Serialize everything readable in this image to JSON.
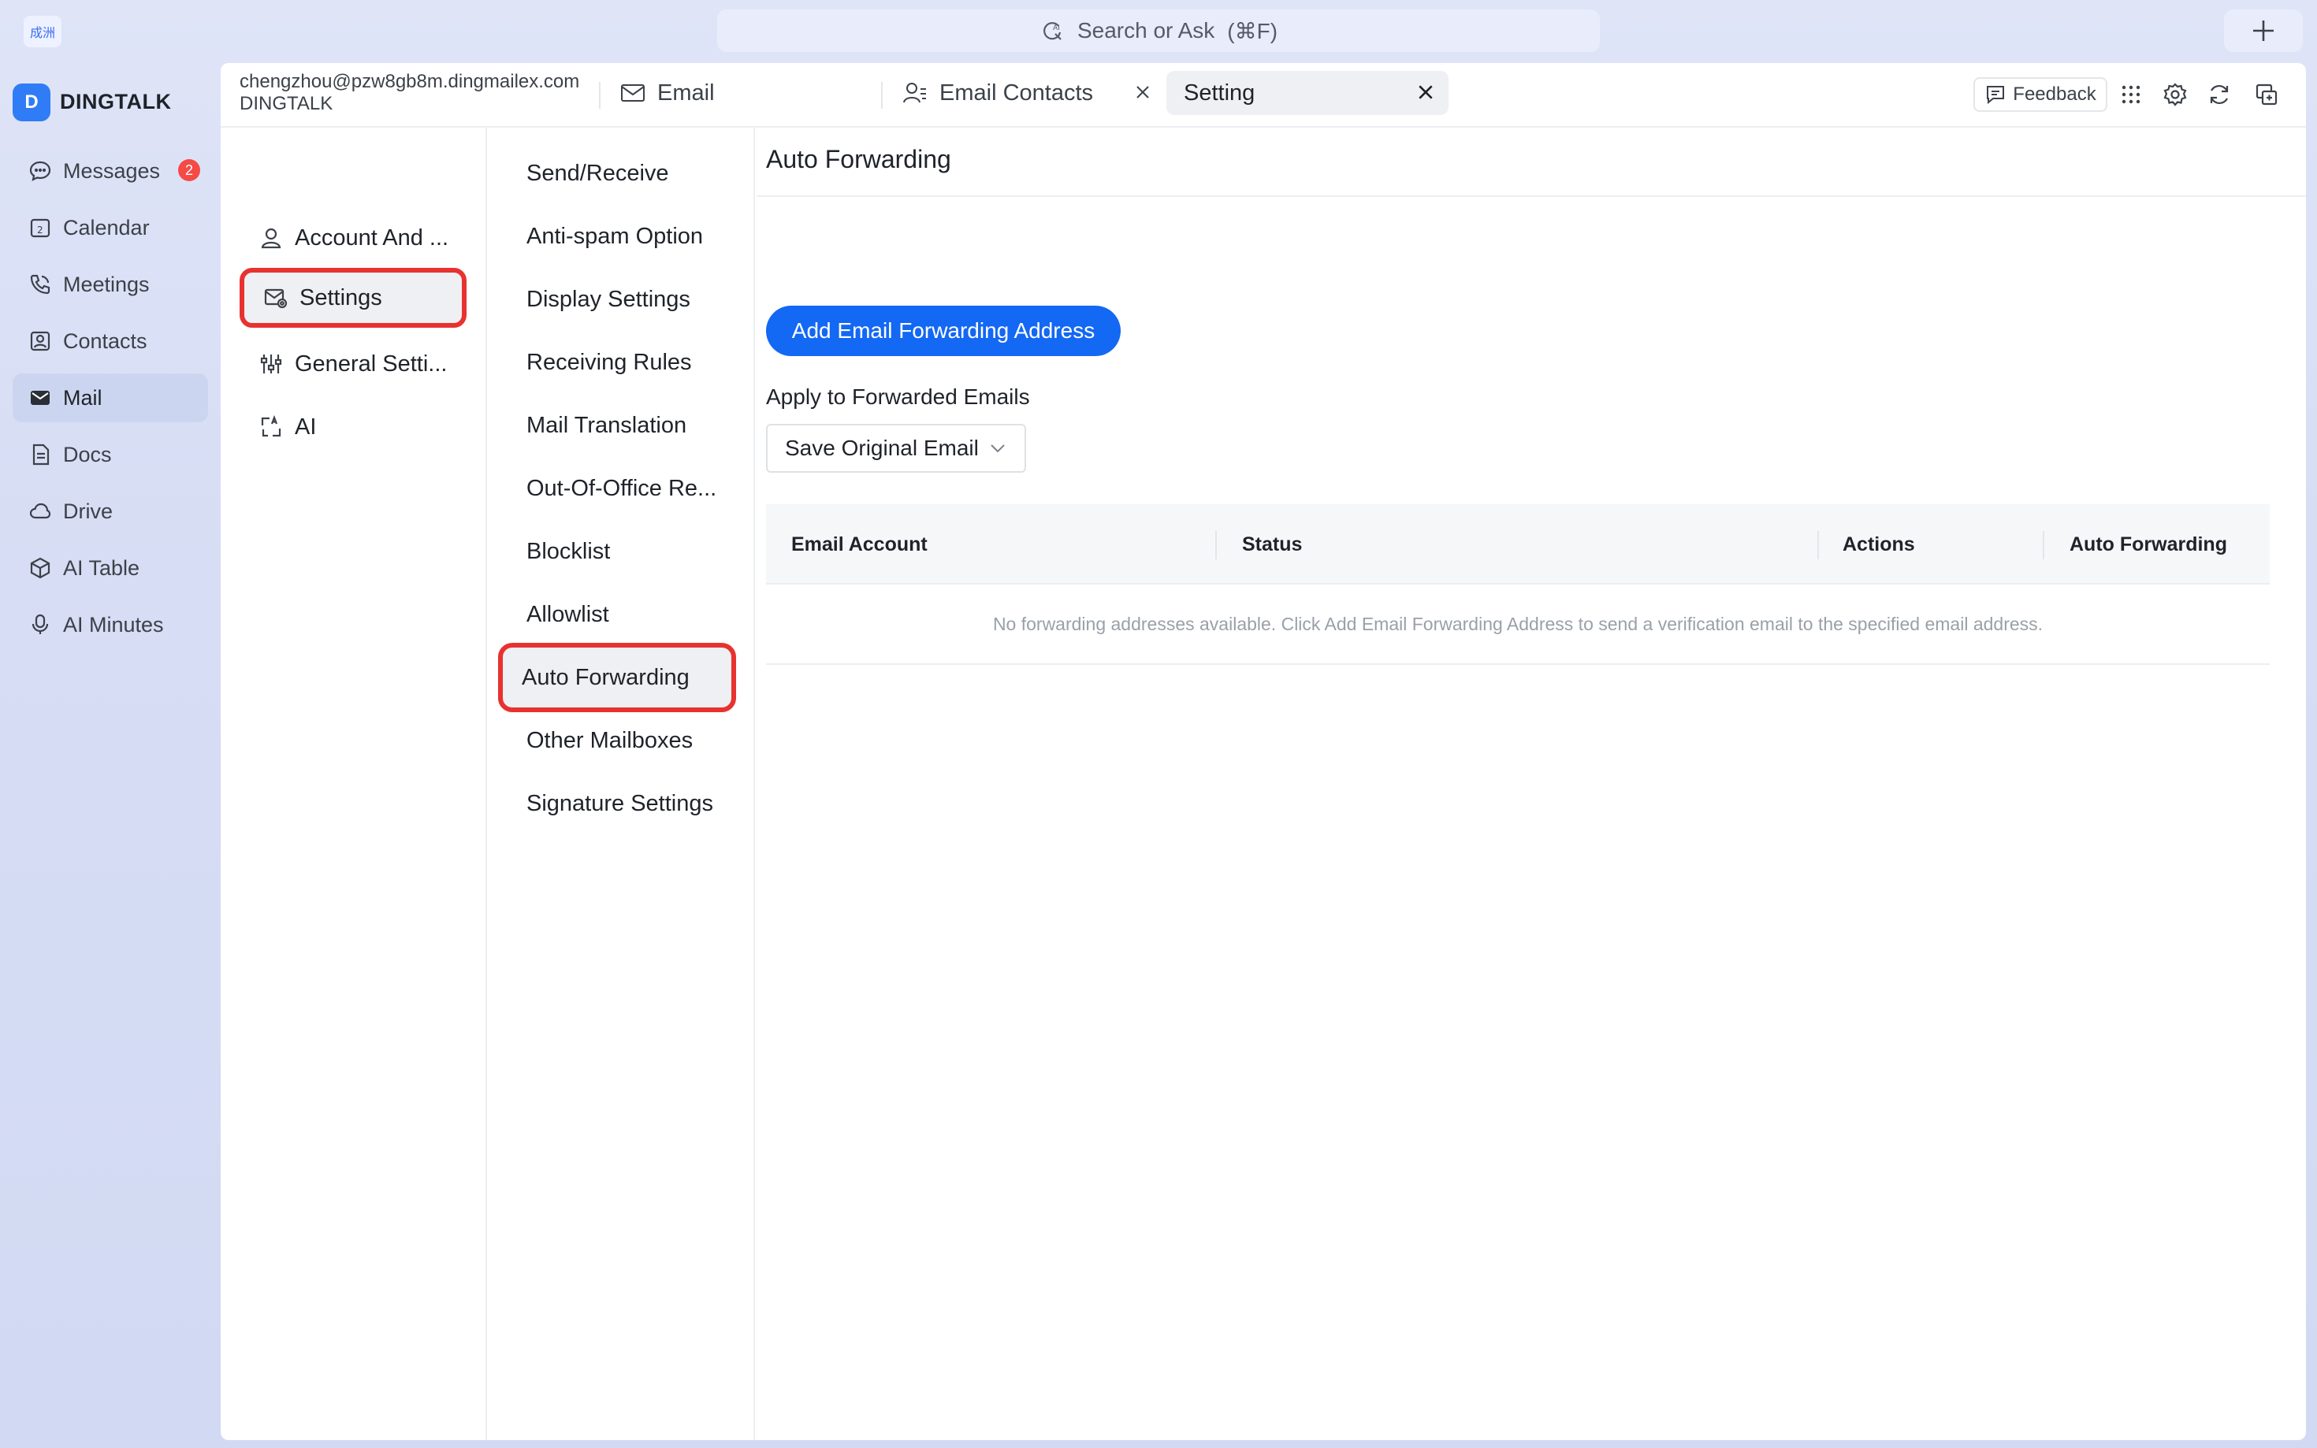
{
  "topbar": {
    "logo_text": "成洲",
    "search_placeholder": "Search or Ask",
    "search_shortcut": "(⌘F)"
  },
  "sidebar": {
    "org_initial": "D",
    "org_name": "DINGTALK",
    "messages_badge": "2",
    "items": [
      {
        "label": "Messages",
        "icon": "chat-bubble-icon"
      },
      {
        "label": "Calendar",
        "icon": "calendar-icon"
      },
      {
        "label": "Meetings",
        "icon": "phone-icon"
      },
      {
        "label": "Contacts",
        "icon": "contact-card-icon"
      },
      {
        "label": "Mail",
        "icon": "mail-icon"
      },
      {
        "label": "Docs",
        "icon": "document-icon"
      },
      {
        "label": "Drive",
        "icon": "cloud-icon"
      },
      {
        "label": "AI Table",
        "icon": "cube-icon"
      },
      {
        "label": "AI Minutes",
        "icon": "microphone-icon"
      }
    ]
  },
  "account": {
    "email": "chengzhou@pzw8gb8m.dingmailex.com",
    "org": "DINGTALK"
  },
  "tabs": {
    "email": "Email",
    "contacts": "Email Contacts",
    "setting": "Setting"
  },
  "toolbar": {
    "feedback": "Feedback"
  },
  "settings_menu": {
    "categories": [
      {
        "label": "Account And ..."
      },
      {
        "label": "Settings"
      },
      {
        "label": "General Setti..."
      },
      {
        "label": "AI"
      }
    ],
    "subitems": [
      "Send/Receive",
      "Anti-spam Option",
      "Display Settings",
      "Receiving Rules",
      "Mail Translation",
      "Out-Of-Office Re...",
      "Blocklist",
      "Allowlist",
      "Auto Forwarding",
      "Other Mailboxes",
      "Signature Settings"
    ]
  },
  "content": {
    "title": "Auto Forwarding",
    "add_button": "Add Email Forwarding Address",
    "apply_label": "Apply to Forwarded Emails",
    "select_value": "Save Original Email",
    "table": {
      "columns": [
        "Email Account",
        "Status",
        "Actions",
        "Auto Forwarding"
      ],
      "empty_text": "No forwarding addresses available. Click Add Email Forwarding Address to send a verification email to the specified email address."
    }
  },
  "colors": {
    "primary": "#1368f4",
    "highlight": "#e8322f",
    "badge": "#f54a45"
  }
}
